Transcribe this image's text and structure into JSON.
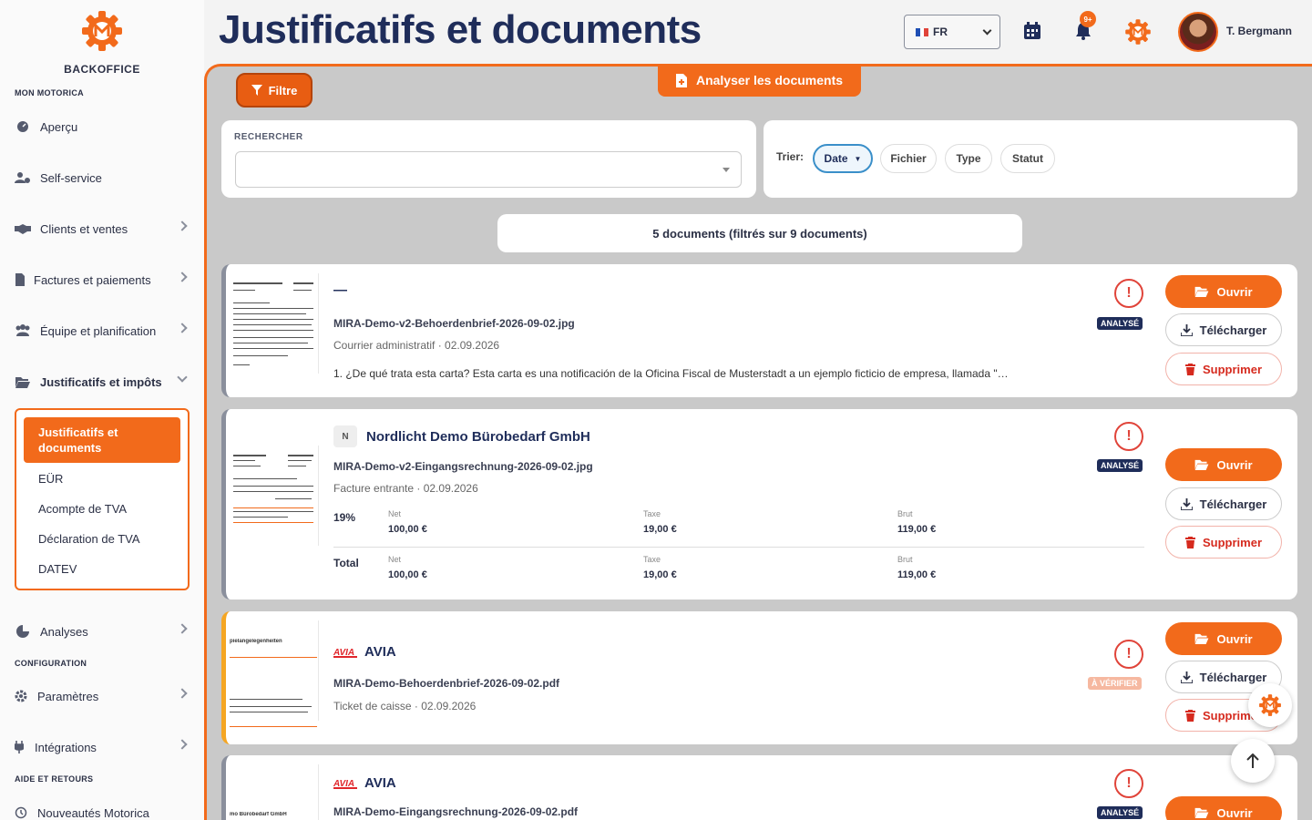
{
  "brand": {
    "name": "BACKOFFICE"
  },
  "colors": {
    "accent": "#f26a1b",
    "navy": "#1f2d5a",
    "danger": "#d62a1e"
  },
  "sidebar": {
    "section_main": "MON MOTORICA",
    "items": [
      {
        "label": "Aperçu",
        "icon": "dashboard-icon"
      },
      {
        "label": "Self-service",
        "icon": "users-cog-icon"
      },
      {
        "label": "Clients et ventes",
        "icon": "handshake-icon"
      },
      {
        "label": "Factures et paiements",
        "icon": "invoice-icon"
      },
      {
        "label": "Équipe et planification",
        "icon": "team-icon"
      },
      {
        "label": "Justificatifs et impôts",
        "icon": "folder-open-icon"
      }
    ],
    "submenu": [
      "Justificatifs et documents",
      "EÜR",
      "Acompte de TVA",
      "Déclaration de TVA",
      "DATEV"
    ],
    "analyses": "Analyses",
    "section_config": "CONFIGURATION",
    "parametres": "Paramètres",
    "integrations": "Intégrations",
    "section_help": "AIDE ET RETOURS",
    "nouveautes": "Nouveautés Motorica"
  },
  "header": {
    "title": "Justificatifs et documents",
    "language": "FR",
    "notif_badge": "9+",
    "user_name": "T. Bergmann"
  },
  "toolbar": {
    "filter_label": "Filtre",
    "analyze_label": "Analyser les documents"
  },
  "search": {
    "label": "RECHERCHER",
    "placeholder": ""
  },
  "sort": {
    "label": "Trier:",
    "options": [
      "Date",
      "Fichier",
      "Type",
      "Statut"
    ],
    "active": "Date"
  },
  "summary": "5 documents (filtrés sur 9 documents)",
  "actions": {
    "open": "Ouvrir",
    "download": "Télécharger",
    "delete": "Supprimer"
  },
  "documents": [
    {
      "title": "—",
      "file": "MIRA-Demo-v2-Behoerdenbrief-2026-09-02.jpg",
      "meta": "Courrier administratif · 02.09.2026",
      "desc": "1. ¿De qué trata esta carta? Esta carta es una notificación de la Oficina Fiscal de Musterstadt a un ejemplo ficticio de empresa, llamada \"…",
      "status": "ANALYSÉ"
    },
    {
      "badge": "N",
      "title": "Nordlicht Demo Bürobedarf GmbH",
      "file": "MIRA-Demo-v2-Eingangsrechnung-2026-09-02.jpg",
      "meta": "Facture entrante · 02.09.2026",
      "status": "ANALYSÉ",
      "tax_rows": [
        {
          "label": "19%",
          "net_label": "Net",
          "net": "100,00 €",
          "tax_label": "Taxe",
          "tax": "19,00 €",
          "gross_label": "Brut",
          "gross": "119,00 €"
        },
        {
          "label": "Total",
          "net_label": "Net",
          "net": "100,00 €",
          "tax_label": "Taxe",
          "tax": "19,00 €",
          "gross_label": "Brut",
          "gross": "119,00 €"
        }
      ]
    },
    {
      "logo": "AVIA",
      "title": "AVIA",
      "file": "MIRA-Demo-Behoerdenbrief-2026-09-02.pdf",
      "meta": "Ticket de caisse · 02.09.2026",
      "status": "À VÉRIFIER",
      "thumb_text": "pielangelegenheiten"
    },
    {
      "logo": "AVIA",
      "title": "AVIA",
      "file": "MIRA-Demo-Eingangsrechnung-2026-09-02.pdf",
      "status": "ANALYSÉ",
      "thumb_text": "mo Bürobedarf GmbH"
    }
  ]
}
